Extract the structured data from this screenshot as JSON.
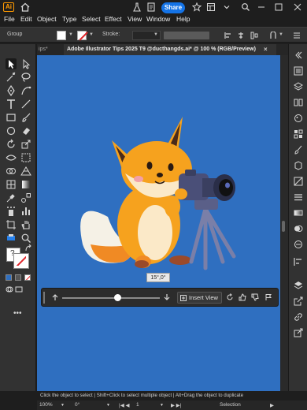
{
  "app": {
    "logo_text": "Ai",
    "share_label": "Share"
  },
  "menu": [
    "File",
    "Edit",
    "Object",
    "Type",
    "Select",
    "Effect",
    "View",
    "Window",
    "Help"
  ],
  "control": {
    "selection_label": "Group",
    "stroke_label": "Stroke:"
  },
  "tabs": {
    "previous_label": "ips*",
    "active_label": "Adobe Illustrator Tips 2025 T9 @ducthangds.ai* @ 100 % (RGB/Preview)",
    "close_glyph": "×"
  },
  "tooltip": {
    "text": "15°,0°"
  },
  "taskbar": {
    "insert_view_label": "Insert View",
    "slider_fraction": 0.56
  },
  "hint": {
    "text": "Click the object to select  |  Shift+Click to select multiple object  |  Alt+Drag the object to duplicate"
  },
  "status": {
    "zoom": "100%",
    "rotation": "0°",
    "artboard": "1",
    "mode": "Selection"
  },
  "colors": {
    "accent": "#1473e6",
    "canvas": "#2f6fc0",
    "logo": "#ff9a00"
  }
}
